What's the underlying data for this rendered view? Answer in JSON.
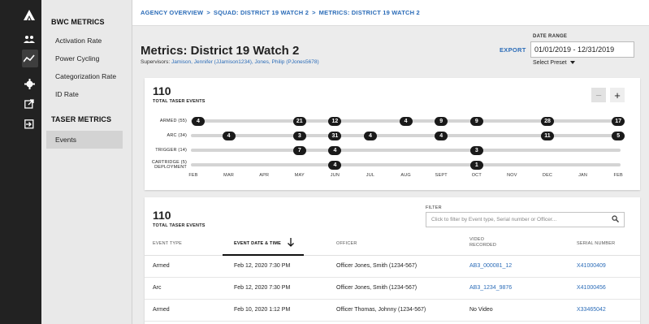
{
  "rail_icons": [
    "logo-icon",
    "users-icon",
    "metrics-icon",
    "gear-icon",
    "export-icon",
    "logout-icon"
  ],
  "nav": {
    "sections": [
      {
        "title": "BWC METRICS",
        "items": [
          "Activation Rate",
          "Power Cycling",
          "Categorization Rate",
          "ID Rate"
        ]
      },
      {
        "title": "TASER METRICS",
        "items": [
          "Events"
        ]
      }
    ],
    "active_item": "Events"
  },
  "breadcrumb": {
    "items": [
      "AGENCY OVERVIEW",
      "SQUAD: DISTRICT 19 WATCH 2",
      "METRICS: DISTRICT 19 WATCH 2"
    ],
    "separator": ">"
  },
  "header": {
    "title": "Metrics: District 19 Watch 2",
    "supervisors_label": "Supervisors:",
    "supervisors": "Jamison, Jennifer (JJamison1234), Jones, Philip (PJones5678)",
    "export": "EXPORT",
    "date_range_label": "DATE RANGE",
    "date_range": "01/01/2019 - 12/31/2019",
    "preset": "Select Preset"
  },
  "timeline": {
    "total": "110",
    "total_label": "TOTAL TASER EVENTS",
    "zoom_out": "−",
    "zoom_in": "+",
    "months": [
      "FEB",
      "MAR",
      "APR",
      "MAY",
      "JUN",
      "JUL",
      "AUG",
      "SEPT",
      "OCT",
      "NOV",
      "DEC",
      "JAN",
      "FEB"
    ],
    "rows": [
      {
        "label": "ARMED (55)",
        "points": [
          {
            "month": 0,
            "count": "4"
          },
          {
            "month": 3,
            "count": "21"
          },
          {
            "month": 4,
            "count": "12"
          },
          {
            "month": 6,
            "count": "4"
          },
          {
            "month": 7,
            "count": "9"
          },
          {
            "month": 8,
            "count": "9"
          },
          {
            "month": 10,
            "count": "28"
          },
          {
            "month": 12,
            "count": "17"
          }
        ]
      },
      {
        "label": "ARC (34)",
        "points": [
          {
            "month": 1,
            "count": "4"
          },
          {
            "month": 3,
            "count": "3"
          },
          {
            "month": 4,
            "count": "31"
          },
          {
            "month": 5,
            "count": "4"
          },
          {
            "month": 7,
            "count": "4"
          },
          {
            "month": 10,
            "count": "11"
          },
          {
            "month": 12,
            "count": "5"
          }
        ]
      },
      {
        "label": "TRIGGER (14)",
        "points": [
          {
            "month": 3,
            "count": "7"
          },
          {
            "month": 4,
            "count": "4"
          },
          {
            "month": 8,
            "count": "3"
          }
        ]
      },
      {
        "label": "CARTRIDGE (5)",
        "label2": "DEPLOYMENT",
        "points": [
          {
            "month": 4,
            "count": "4"
          },
          {
            "month": 8,
            "count": "1"
          }
        ]
      }
    ]
  },
  "table": {
    "total": "110",
    "total_label": "TOTAL TASER EVENTS",
    "filter_label": "FILTER",
    "filter_placeholder": "Click to filter by Event type, Serial number or Officer...",
    "columns": [
      "EVENT TYPE",
      "EVENT DATE & TIME",
      "OFFICER",
      "VIDEO RECORDED",
      "SERIAL NUMBER"
    ],
    "rows": [
      {
        "type": "Armed",
        "datetime": "Feb 12, 2020 7:30 PM",
        "officer": "Officer Jones, Smith (1234-567)",
        "video": "AB3_000081_12",
        "video_link": true,
        "serial": "X41000409"
      },
      {
        "type": "Arc",
        "datetime": "Feb 12, 2020 7:30 PM",
        "officer": "Officer Jones, Smith (1234-567)",
        "video": "AB3_1234_9876",
        "video_link": true,
        "serial": "X41000456"
      },
      {
        "type": "Armed",
        "datetime": "Feb 10, 2020 1:12 PM",
        "officer": "Officer Thomas, Johnny (1234-567)",
        "video": "No Video",
        "video_link": false,
        "serial": "X33465042"
      }
    ]
  },
  "colors": {
    "accent": "#2b6cb8",
    "pill": "#1a1a1a",
    "track": "#d4d4d4",
    "rail": "#222222",
    "nav": "#e9e9e9"
  }
}
